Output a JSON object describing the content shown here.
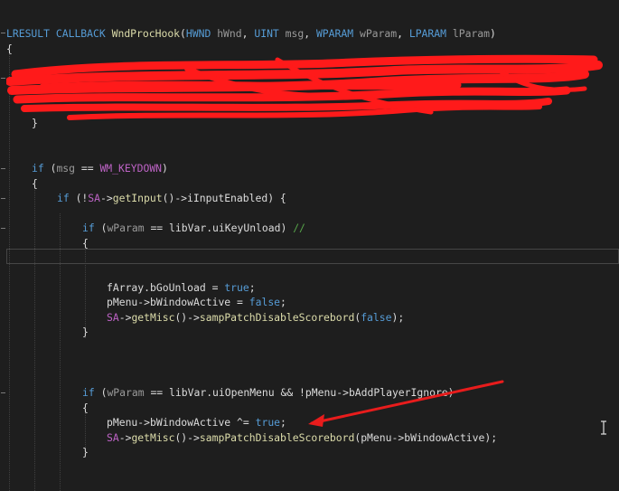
{
  "editor": {
    "lines": {
      "l1": {
        "t1": "LRESULT",
        "t2": " ",
        "t3": "CALLBACK",
        "t4": " ",
        "t5": "WndProcHook",
        "t6": "(",
        "t7": "HWND",
        "t8": " ",
        "t9": "hWnd",
        "t10": ", ",
        "t11": "UINT",
        "t12": " ",
        "t13": "msg",
        "t14": ", ",
        "t15": "WPARAM",
        "t16": " ",
        "t17": "wParam",
        "t18": ", ",
        "t19": "LPARAM",
        "t20": " ",
        "t21": "lParam",
        "t22": ")"
      },
      "l2": {
        "t1": "{"
      },
      "l3": {
        "t1": "}"
      },
      "l4": {
        "t1": "if",
        "t2": " (",
        "t3": "msg",
        "t4": " == ",
        "t5": "WM_KEYDOWN",
        "t6": ")"
      },
      "l5": {
        "t1": "{"
      },
      "l6": {
        "t1": "if",
        "t2": " (!",
        "t3": "SA",
        "t4": "->",
        "t5": "getInput",
        "t6": "()->",
        "t7": "iInputEnabled",
        "t8": ") {"
      },
      "l7": {
        "t1": "if",
        "t2": " (",
        "t3": "wParam",
        "t4": " == ",
        "t5": "libVar",
        "t6": ".",
        "t7": "uiKeyUnload",
        "t8": ") ",
        "t9": "//"
      },
      "l8": {
        "t1": "{"
      },
      "l9": {
        "t1": "fArray",
        "t2": ".",
        "t3": "bGoUnload",
        "t4": " = ",
        "t5": "true",
        "t6": ";"
      },
      "l10": {
        "t1": "pMenu",
        "t2": "->",
        "t3": "bWindowActive",
        "t4": " = ",
        "t5": "false",
        "t6": ";"
      },
      "l11": {
        "t1": "SA",
        "t2": "->",
        "t3": "getMisc",
        "t4": "()->",
        "t5": "sampPatchDisableScorebord",
        "t6": "(",
        "t7": "false",
        "t8": ");"
      },
      "l12": {
        "t1": "}"
      },
      "l13": {
        "t1": "if",
        "t2": " (",
        "t3": "wParam",
        "t4": " == ",
        "t5": "libVar",
        "t6": ".",
        "t7": "uiOpenMenu",
        "t8": " && !",
        "t9": "pMenu",
        "t10": "->",
        "t11": "bAddPlayerIgnore",
        "t12": ")"
      },
      "l14": {
        "t1": "{"
      },
      "l15": {
        "t1": "pMenu",
        "t2": "->",
        "t3": "bWindowActive",
        "t4": " ^= ",
        "t5": "true",
        "t6": ";"
      },
      "l16": {
        "t1": "SA",
        "t2": "->",
        "t3": "getMisc",
        "t4": "()->",
        "t5": "sampPatchDisableScorebord",
        "t6": "(",
        "t7": "pMenu",
        "t8": "->",
        "t9": "bWindowActive",
        "t10": ");"
      },
      "l17": {
        "t1": "}"
      }
    }
  },
  "annotations": {
    "scribble_color": "#ff1a1a",
    "arrow_color": "#e81c1c"
  },
  "colors": {
    "background": "#1e1e1e",
    "keyword": "#569cd6",
    "macro": "#bd63c5",
    "type": "#4ec9b0",
    "function": "#dcdcaa",
    "comment": "#57a64a"
  }
}
